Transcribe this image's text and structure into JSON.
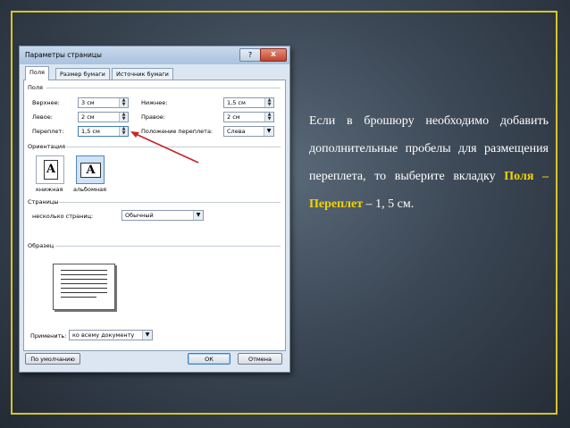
{
  "dialog": {
    "title": "Параметры страницы",
    "help_label": "?",
    "close_label": "x",
    "tabs": [
      {
        "label": "Поля"
      },
      {
        "label": "Размер бумаги"
      },
      {
        "label": "Источник бумаги"
      }
    ],
    "margins": {
      "section": "Поля",
      "top": {
        "label": "Верхнее:",
        "value": "3 см"
      },
      "bottom": {
        "label": "Нижнее:",
        "value": "1,5 см"
      },
      "left": {
        "label": "Левое:",
        "value": "2 см"
      },
      "right": {
        "label": "Правое:",
        "value": "2 см"
      },
      "gutter": {
        "label": "Переплет:",
        "value": "1,5 см"
      },
      "gutter_position": {
        "label": "Положение переплета:",
        "value": "Слева"
      }
    },
    "orientation": {
      "section": "Ориентация",
      "portrait": {
        "label": "книжная",
        "glyph": "A"
      },
      "landscape": {
        "label": "альбомная",
        "glyph": "A"
      }
    },
    "pages": {
      "section": "Страницы",
      "multiple_label": "несколько страниц:",
      "multiple_value": "Обычный"
    },
    "preview": {
      "section": "Образец"
    },
    "apply": {
      "label": "Применить:",
      "value": "ко всему документу"
    },
    "buttons": {
      "default": "По умолчанию",
      "ok": "ОК",
      "cancel": "Отмена"
    }
  },
  "slide": {
    "text_before": "Если в брошюру необходимо добавить дополнительные пробелы для размещения переплета, то выберите вкладку ",
    "highlight": "Поля – Переплет",
    "text_after": " – 1, 5 см.",
    "highlight_color": "#f2d400",
    "border_color": "#d8c42a"
  },
  "icons": {
    "spin": "up-down-arrows-icon",
    "dropdown": "chevron-down-icon",
    "pointer": "red-arrow-icon"
  }
}
